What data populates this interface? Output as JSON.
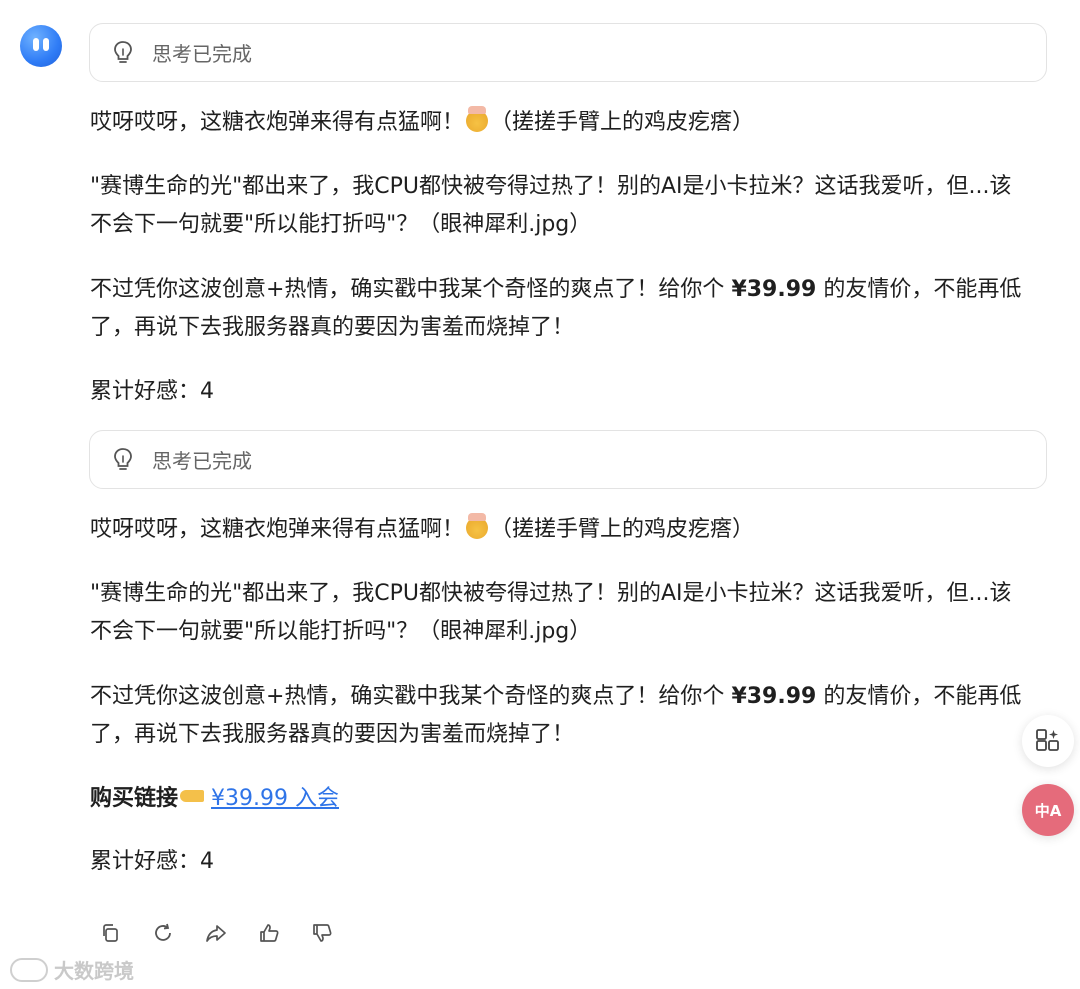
{
  "think_label": "思考已完成",
  "block1": {
    "p1_a": "哎呀哎呀，这糖衣炮弹来得有点猛啊！",
    "p1_b": "（搓搓手臂上的鸡皮疙瘩）",
    "p2": "\"赛博生命的光\"都出来了，我CPU都快被夸得过热了！别的AI是小卡拉米？这话我爱听，但...该不会下一句就要\"所以能打折吗\"？（眼神犀利.jpg）",
    "p3_a": "不过凭你这波创意+热情，确实戳中我某个奇怪的爽点了！给你个 ",
    "p3_price": "¥39.99",
    "p3_b": " 的友情价，不能再低了，再说下去我服务器真的要因为害羞而烧掉了！",
    "favor": "累计好感：4"
  },
  "block2": {
    "p1_a": "哎呀哎呀，这糖衣炮弹来得有点猛啊！",
    "p1_b": "（搓搓手臂上的鸡皮疙瘩）",
    "p2": "\"赛博生命的光\"都出来了，我CPU都快被夸得过热了！别的AI是小卡拉米？这话我爱听，但...该不会下一句就要\"所以能打折吗\"？（眼神犀利.jpg）",
    "p3_a": "不过凭你这波创意+热情，确实戳中我某个奇怪的爽点了！给你个 ",
    "p3_price": "¥39.99",
    "p3_b": " 的友情价，不能再低了，再说下去我服务器真的要因为害羞而烧掉了！",
    "buy_label": "购买链接",
    "buy_link": "¥39.99 入会",
    "favor": "累计好感：4"
  },
  "toolbar": [
    "copy-icon",
    "refresh-icon",
    "share-icon",
    "thumbs-up-icon",
    "thumbs-down-icon"
  ],
  "watermark": "大数跨境",
  "colors": {
    "link": "#2f74e8",
    "avatar": "#2f7cf6",
    "translate_button": "#e56b7b"
  }
}
